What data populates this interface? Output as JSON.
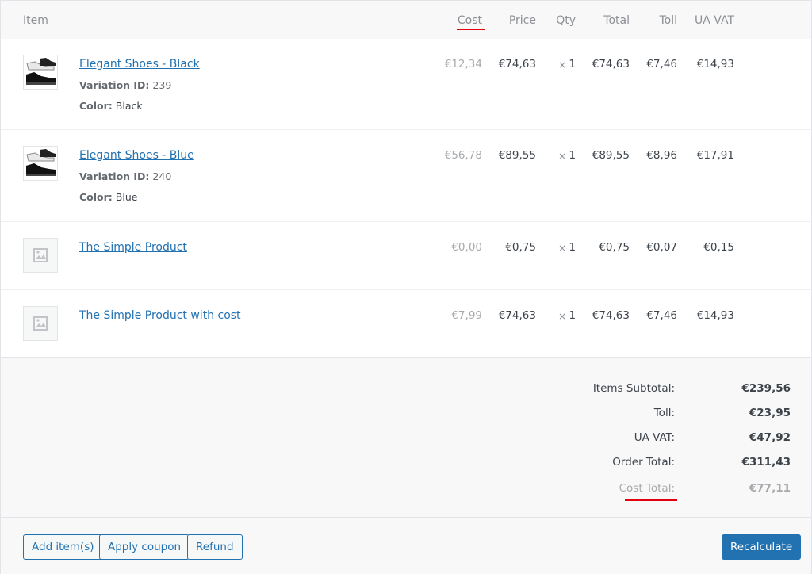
{
  "header": {
    "item": "Item",
    "cost": "Cost",
    "price": "Price",
    "qty": "Qty",
    "total": "Total",
    "toll": "Toll",
    "vat": "UA VAT"
  },
  "items": [
    {
      "name": "Elegant Shoes - Black",
      "variation_label": "Variation ID:",
      "variation_id": "239",
      "color_label": "Color:",
      "color": "Black",
      "thumb": "shoes-image",
      "cost": "€12,34",
      "price": "€74,63",
      "qty_x": "×",
      "qty": "1",
      "total": "€74,63",
      "toll": "€7,46",
      "vat": "€14,93"
    },
    {
      "name": "Elegant Shoes - Blue",
      "variation_label": "Variation ID:",
      "variation_id": "240",
      "color_label": "Color:",
      "color": "Blue",
      "thumb": "shoes-image",
      "cost": "€56,78",
      "price": "€89,55",
      "qty_x": "×",
      "qty": "1",
      "total": "€89,55",
      "toll": "€8,96",
      "vat": "€17,91"
    },
    {
      "name": "The Simple Product",
      "thumb": "placeholder-image-icon",
      "cost": "€0,00",
      "price": "€0,75",
      "qty_x": "×",
      "qty": "1",
      "total": "€0,75",
      "toll": "€0,07",
      "vat": "€0,15"
    },
    {
      "name": "The Simple Product with cost",
      "thumb": "placeholder-image-icon",
      "cost": "€7,99",
      "price": "€74,63",
      "qty_x": "×",
      "qty": "1",
      "total": "€74,63",
      "toll": "€7,46",
      "vat": "€14,93"
    }
  ],
  "totals": {
    "subtotal_label": "Items Subtotal:",
    "subtotal": "€239,56",
    "toll_label": "Toll:",
    "toll": "€23,95",
    "vat_label": "UA VAT:",
    "vat": "€47,92",
    "order_label": "Order Total:",
    "order": "€311,43",
    "cost_label": "Cost Total:",
    "cost": "€77,11"
  },
  "actions": {
    "add_items": "Add item(s)",
    "apply_coupon": "Apply coupon",
    "refund": "Refund",
    "recalculate": "Recalculate"
  },
  "colors": {
    "link": "#2271b1",
    "highlight_underline": "#e3000f",
    "muted": "#a7aaad"
  }
}
